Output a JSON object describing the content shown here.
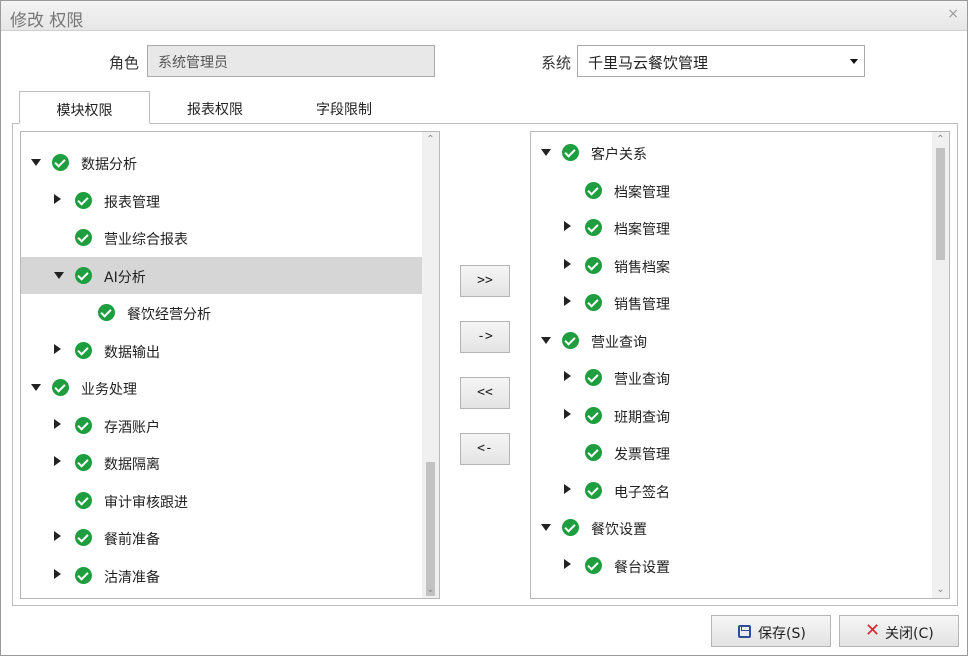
{
  "window": {
    "title": "修改 权限",
    "close_glyph": "×"
  },
  "form": {
    "role_label": "角色",
    "role_value": "系统管理员",
    "system_label": "系统",
    "system_value": "千里马云餐饮管理"
  },
  "tabs": [
    {
      "label": "模块权限",
      "active": true
    },
    {
      "label": "报表权限",
      "active": false
    },
    {
      "label": "字段限制",
      "active": false
    }
  ],
  "left_tree": [
    {
      "label": "数据分析",
      "level": 0,
      "expander": "down",
      "checked": true,
      "selected": false
    },
    {
      "label": "报表管理",
      "level": 1,
      "expander": "right",
      "checked": true,
      "selected": false
    },
    {
      "label": "营业综合报表",
      "level": 1,
      "expander": "none",
      "checked": true,
      "selected": false
    },
    {
      "label": "AI分析",
      "level": 1,
      "expander": "down",
      "checked": true,
      "selected": true
    },
    {
      "label": "餐饮经营分析",
      "level": 2,
      "expander": "none",
      "checked": true,
      "selected": false
    },
    {
      "label": "数据输出",
      "level": 1,
      "expander": "right",
      "checked": true,
      "selected": false
    },
    {
      "label": "业务处理",
      "level": 0,
      "expander": "down",
      "checked": true,
      "selected": false
    },
    {
      "label": "存酒账户",
      "level": 1,
      "expander": "right",
      "checked": true,
      "selected": false
    },
    {
      "label": "数据隔离",
      "level": 1,
      "expander": "right",
      "checked": true,
      "selected": false
    },
    {
      "label": "审计审核跟进",
      "level": 1,
      "expander": "none",
      "checked": true,
      "selected": false
    },
    {
      "label": "餐前准备",
      "level": 1,
      "expander": "right",
      "checked": true,
      "selected": false
    },
    {
      "label": "沽清准备",
      "level": 1,
      "expander": "right",
      "checked": true,
      "selected": false
    }
  ],
  "right_tree": [
    {
      "label": "客户关系",
      "level": 0,
      "expander": "down",
      "checked": true
    },
    {
      "label": "档案管理",
      "level": 1,
      "expander": "none",
      "checked": true
    },
    {
      "label": "档案管理",
      "level": 1,
      "expander": "right",
      "checked": true
    },
    {
      "label": "销售档案",
      "level": 1,
      "expander": "right",
      "checked": true
    },
    {
      "label": "销售管理",
      "level": 1,
      "expander": "right",
      "checked": true
    },
    {
      "label": "营业查询",
      "level": 0,
      "expander": "down",
      "checked": true
    },
    {
      "label": "营业查询",
      "level": 1,
      "expander": "right",
      "checked": true
    },
    {
      "label": "班期查询",
      "level": 1,
      "expander": "right",
      "checked": true
    },
    {
      "label": "发票管理",
      "level": 1,
      "expander": "none",
      "checked": true
    },
    {
      "label": "电子签名",
      "level": 1,
      "expander": "right",
      "checked": true
    },
    {
      "label": "餐饮设置",
      "level": 0,
      "expander": "down",
      "checked": true
    },
    {
      "label": "餐台设置",
      "level": 1,
      "expander": "right",
      "checked": true
    }
  ],
  "transfer_buttons": [
    {
      "label": ">>",
      "name": "move-all-right-button"
    },
    {
      "label": "->",
      "name": "move-right-button"
    },
    {
      "label": "<<",
      "name": "move-all-left-button"
    },
    {
      "label": "<-",
      "name": "move-left-button"
    }
  ],
  "footer": {
    "save_label": "保存(S)",
    "close_label": "关闭(C)"
  },
  "colors": {
    "check_green": "#1e9e3e",
    "selected_row": "#d6d6d6",
    "close_red": "#d9262c",
    "save_blue": "#2d4e9c"
  }
}
